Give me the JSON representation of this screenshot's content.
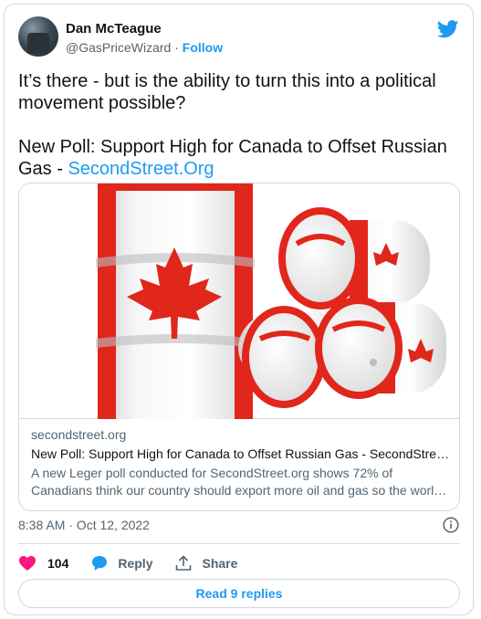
{
  "author": {
    "display_name": "Dan McTeague",
    "handle": "@GasPriceWizard",
    "separator": " · ",
    "follow_label": "Follow"
  },
  "tweet": {
    "text_line1": "It’s there - but is the ability to turn this into a political movement possible?",
    "text_line2": "New Poll: Support High for Canada to Offset Russian Gas - ",
    "link_text": "SecondStreet.Org"
  },
  "card": {
    "domain": "secondstreet.org",
    "title": "New Poll: Support High for Canada to Offset Russian Gas - SecondStreet…",
    "description": "A new Leger poll conducted for SecondStreet.org shows 72% of Canadians think our country should export more oil and gas so the worl…",
    "image_icon": "canada-flag-oil-barrels-image"
  },
  "meta": {
    "timestamp": "8:38 AM · Oct 12, 2022"
  },
  "actions": {
    "like_count": "104",
    "reply_label": "Reply",
    "share_label": "Share"
  },
  "footer": {
    "read_replies_label": "Read 9 replies"
  },
  "colors": {
    "accent": "#1d9bf0",
    "like": "#f91880",
    "text": "#0f1419",
    "muted": "#536471",
    "border": "#cfd9de",
    "flag_red": "#e1261c"
  }
}
